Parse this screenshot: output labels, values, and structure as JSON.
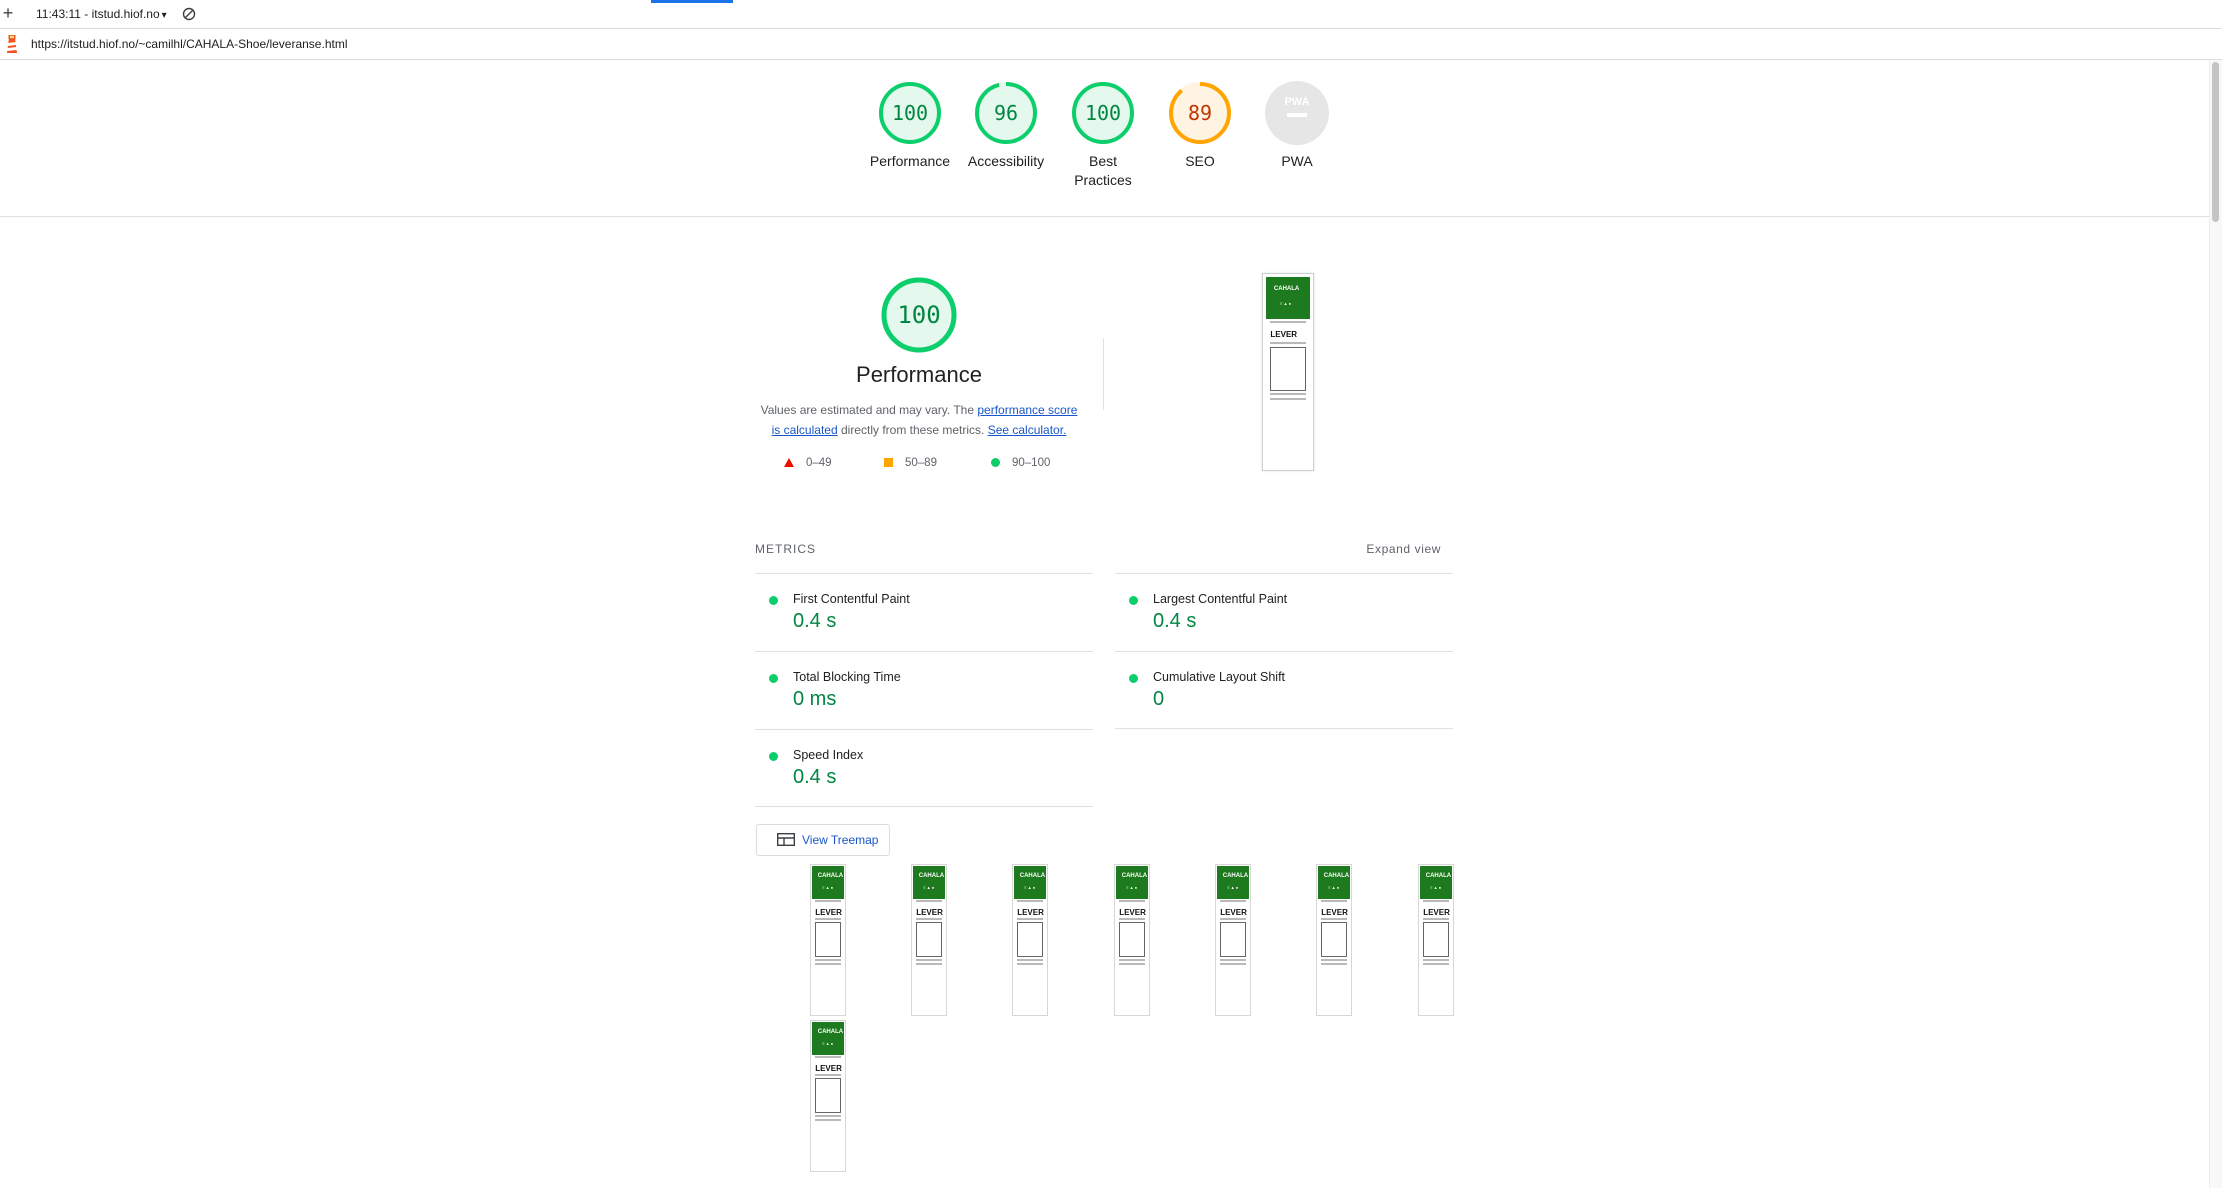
{
  "toolbar": {
    "new_report_icon": "plus-icon",
    "report_selector": "11:43:11 - itstud.hiof.no",
    "clear_icon": "clear-circle-icon"
  },
  "urlbar": {
    "logo": "lighthouse-logo",
    "url": "https://itstud.hiof.no/~camilhl/CAHALA-Shoe/leveranse.html"
  },
  "gauges": [
    {
      "label": "Performance",
      "score": "100",
      "score_value": 100,
      "color": "#0cce6b",
      "text_color": "#018642",
      "fill": "#e5f8ee"
    },
    {
      "label": "Accessibility",
      "score": "96",
      "score_value": 96,
      "color": "#0cce6b",
      "text_color": "#018642",
      "fill": "#e5f8ee"
    },
    {
      "label": "Best Practices",
      "score": "100",
      "score_value": 100,
      "color": "#0cce6b",
      "text_color": "#018642",
      "fill": "#e5f8ee"
    },
    {
      "label": "SEO",
      "score": "89",
      "score_value": 89,
      "color": "#ffa400",
      "text_color": "#c33300",
      "fill": "#fff4e1"
    },
    {
      "label": "PWA",
      "badge": "PWA",
      "color": "#dadada",
      "fill": "#e6e6e6"
    }
  ],
  "performance": {
    "score": "100",
    "score_value": 100,
    "title": "Performance",
    "desc_prefix": "Values are estimated and may vary. The ",
    "desc_link1": "performance score is calculated",
    "desc_middle": " directly from these metrics. ",
    "desc_link2": "See calculator.",
    "legend": [
      {
        "range": "0–49",
        "icon": "triangle-icon",
        "color": "#eb0f00"
      },
      {
        "range": "50–89",
        "icon": "square-icon",
        "color": "#ffa400"
      },
      {
        "range": "90–100",
        "icon": "circle-icon",
        "color": "#0cce6b"
      }
    ]
  },
  "metrics": {
    "title": "METRICS",
    "expand": "Expand view",
    "items": [
      {
        "title": "First Contentful Paint",
        "value": "0.4 s"
      },
      {
        "title": "Largest Contentful Paint",
        "value": "0.4 s"
      },
      {
        "title": "Total Blocking Time",
        "value": "0 ms"
      },
      {
        "title": "Cumulative Layout Shift",
        "value": "0"
      },
      {
        "title": "Speed Index",
        "value": "0.4 s"
      }
    ]
  },
  "treemap": {
    "label": "View Treemap",
    "icon": "treemap-icon"
  },
  "thumbnail": {
    "brand": "CAHALA",
    "heading": "LEVER",
    "color": "#1e7a1e"
  }
}
